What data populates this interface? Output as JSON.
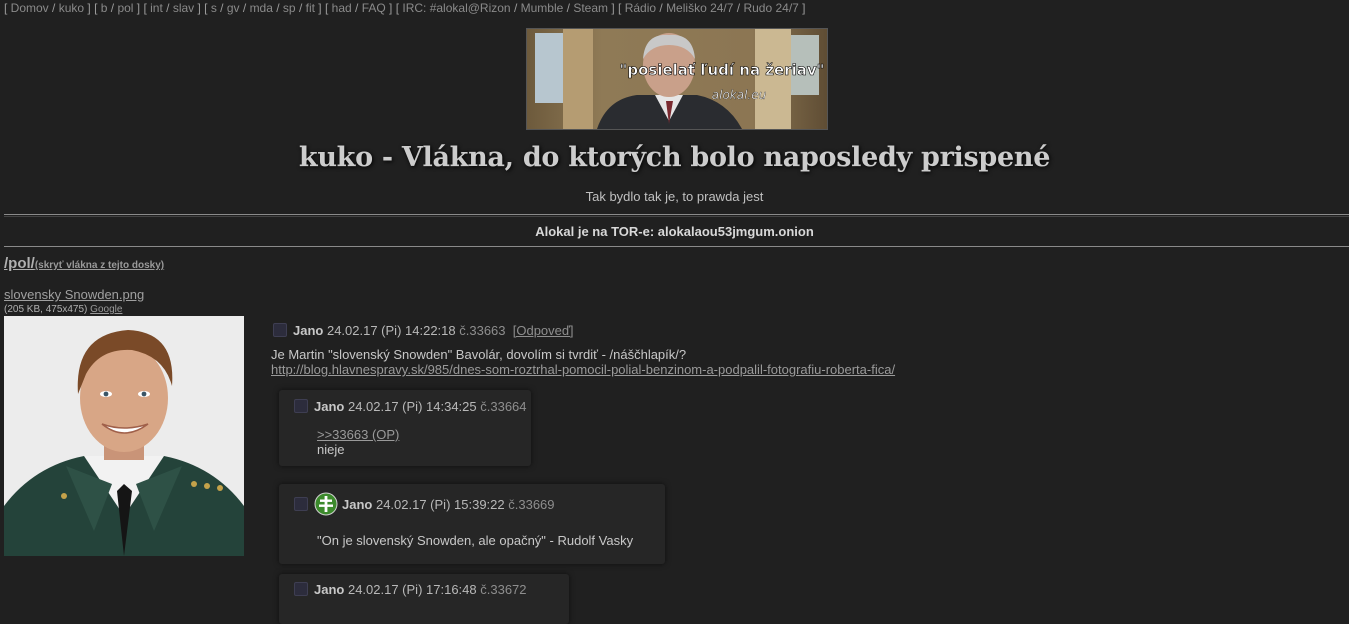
{
  "nav": {
    "groups": [
      [
        "Domov",
        "kuko"
      ],
      [
        "b",
        "pol"
      ],
      [
        "int",
        "slav"
      ],
      [
        "s",
        "gv",
        "mda",
        "sp",
        "fit"
      ],
      [
        "had",
        "FAQ"
      ],
      [
        "IRC: #alokal@Rizon",
        "Mumble",
        "Steam"
      ],
      [
        "Rádio",
        "Meliško 24/7",
        "Rudo 24/7"
      ]
    ]
  },
  "banner": {
    "caption": "\"posielať ľudí na žeriav\"",
    "watermark": "alokal.eu"
  },
  "header": {
    "title": "kuko - Vlákna, do ktorých bolo naposledy prispené",
    "subtitle": "Tak bydlo tak je, to prawda jest",
    "tor_notice": "Alokal je na TOR-e: alokalaou53jmgum.onion"
  },
  "board": {
    "name": "/pol/",
    "hide_label": "(skryť vlákna z tejto dosky)"
  },
  "file": {
    "name": "slovensky Snowden.png",
    "info": "(205 KB, 475x475)",
    "google": "Google"
  },
  "op": {
    "name": "Jano",
    "date": "24.02.17 (Pi) 14:22:18",
    "num": "č.33663",
    "reply_label": "[Odpoveď]",
    "text": "Je Martin \"slovenský Snowden\" Bavolár, dovolím si tvrdiť - /náščhlapík/?",
    "link": "http://blog.hlavnespravy.sk/985/dnes-som-roztrhal-pomocil-polial-benzinom-a-podpalil-fotografiu-roberta-fica/"
  },
  "replies": [
    {
      "name": "Jano",
      "date": "24.02.17 (Pi) 14:34:25",
      "num": "č.33664",
      "quote": ">>33663 (OP)",
      "text": "nieje"
    },
    {
      "name": "Jano",
      "date": "24.02.17 (Pi) 15:39:22",
      "num": "č.33669",
      "text": "\"On je slovenský Snowden, ale opačný\" - Rudolf Vasky"
    },
    {
      "name": "Jano",
      "date": "24.02.17 (Pi) 17:16:48",
      "num": "č.33672"
    }
  ]
}
